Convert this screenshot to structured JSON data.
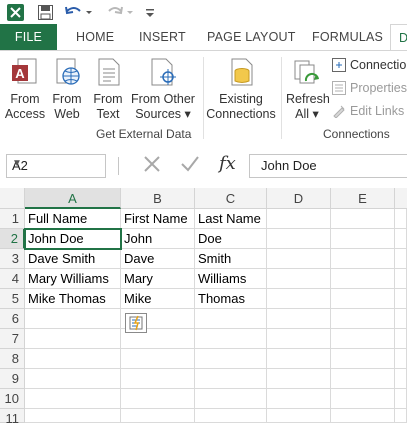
{
  "ribbon_tabs": [
    "FILE",
    "HOME",
    "INSERT",
    "PAGE LAYOUT",
    "FORMULAS",
    "D"
  ],
  "ribbon": {
    "from_access": [
      "From",
      "Access"
    ],
    "from_web": [
      "From",
      "Web"
    ],
    "from_text": [
      "From",
      "Text"
    ],
    "from_other_sources": [
      "From Other",
      "Sources ▾"
    ],
    "existing_connections": [
      "Existing",
      "Connections"
    ],
    "refresh_all": [
      "Refresh",
      "All ▾"
    ],
    "connections_label": "Connections",
    "properties_label": "Properties",
    "edit_links_label": "Edit Links",
    "group_get_external_data": "Get External Data",
    "group_connections": "Connections"
  },
  "formula_bar": {
    "name_box": "A2",
    "fx_symbol": "fx",
    "content": "John Doe"
  },
  "columns": [
    "A",
    "B",
    "C",
    "D",
    "E"
  ],
  "rows": [
    "1",
    "2",
    "3",
    "4",
    "5",
    "6",
    "7",
    "8",
    "9",
    "10",
    "11"
  ],
  "cells": [
    [
      "Full Name",
      "First Name",
      "Last Name"
    ],
    [
      "John Doe",
      "John",
      "Doe"
    ],
    [
      "Dave Smith",
      "Dave",
      "Smith"
    ],
    [
      "Mary Williams",
      "Mary",
      "Williams"
    ],
    [
      "Mike Thomas",
      "Mike",
      "Thomas"
    ]
  ],
  "colors": {
    "accent": "#217346"
  }
}
